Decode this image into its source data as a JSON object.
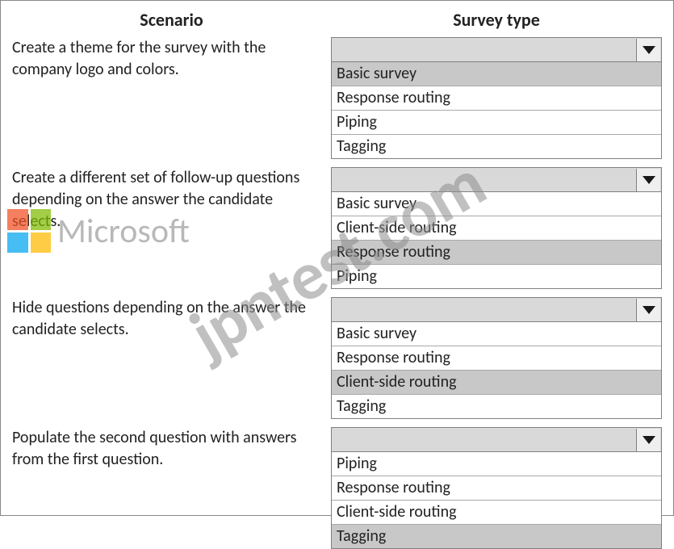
{
  "headers": {
    "scenario": "Scenario",
    "survey_type": "Survey type"
  },
  "rows": [
    {
      "scenario": "Create a theme for the survey with the company logo and colors.",
      "options": [
        "Basic survey",
        "Response routing",
        "Piping",
        "Tagging"
      ],
      "selected_index": 0
    },
    {
      "scenario": "Create a different set of follow-up questions depending on the answer the candidate selects.",
      "options": [
        "Basic survey",
        "Client-side routing",
        "Response routing",
        "Piping"
      ],
      "selected_index": 2
    },
    {
      "scenario": "Hide questions depending on the answer the candidate selects.",
      "options": [
        "Basic survey",
        "Response routing",
        "Client-side routing",
        "Tagging"
      ],
      "selected_index": 2
    },
    {
      "scenario": "Populate the second question with answers from the first question.",
      "options": [
        "Piping",
        "Response routing",
        "Client-side routing",
        "Tagging"
      ],
      "selected_index": 3
    }
  ],
  "logo_text": "Microsoft",
  "watermark": "jpntest.com"
}
